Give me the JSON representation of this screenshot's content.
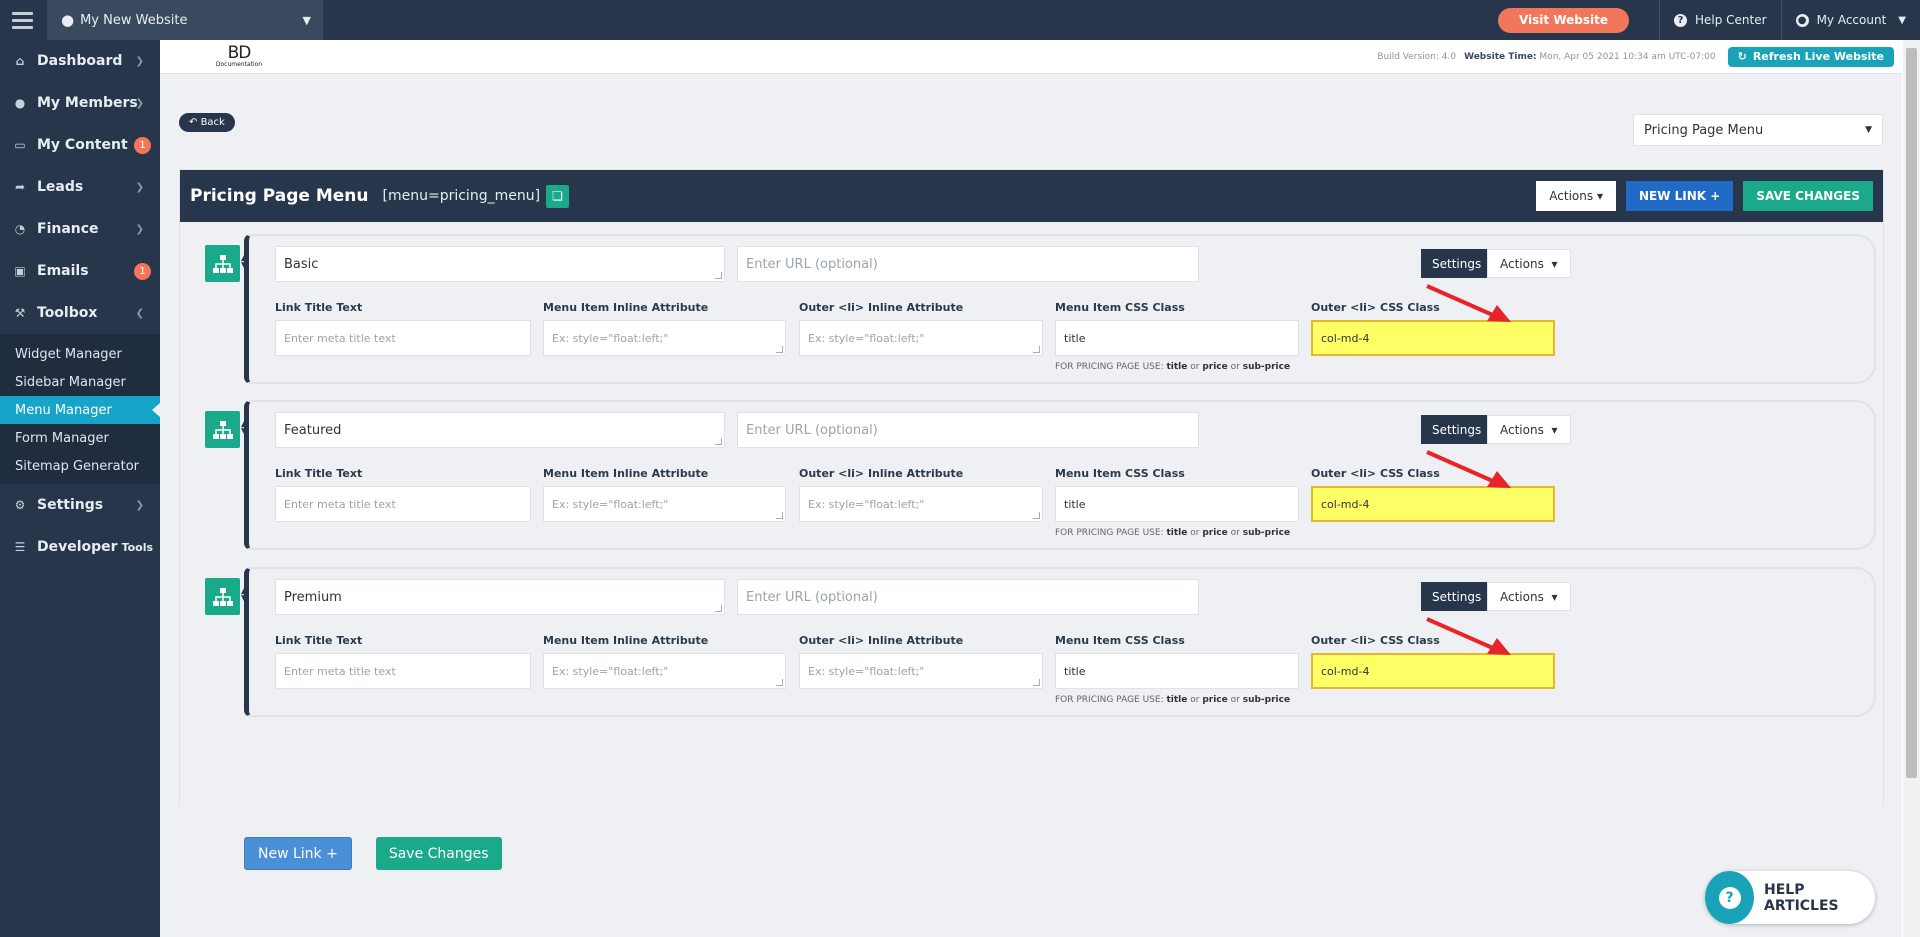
{
  "topbar": {
    "site_name": "My New Website",
    "visit_label": "Visit Website",
    "help_label": "Help Center",
    "account_label": "My Account"
  },
  "sidebar": {
    "items": [
      {
        "label": "Dashboard",
        "icon": "home-icon"
      },
      {
        "label": "My Members",
        "icon": "users-icon"
      },
      {
        "label": "My Content",
        "icon": "folder-icon",
        "badge": "1"
      },
      {
        "label": "Leads",
        "icon": "share-icon"
      },
      {
        "label": "Finance",
        "icon": "pie-chart-icon"
      },
      {
        "label": "Emails",
        "icon": "inbox-icon",
        "badge": "1"
      },
      {
        "label": "Toolbox",
        "icon": "wrench-icon"
      },
      {
        "label": "Settings",
        "icon": "gear-icon"
      },
      {
        "label": "Developer",
        "sub": "Tools",
        "icon": "sliders-icon"
      }
    ],
    "subitems": [
      "Widget Manager",
      "Sidebar Manager",
      "Menu Manager",
      "Form Manager",
      "Sitemap Generator"
    ]
  },
  "subheader": {
    "logo_main": "BD",
    "logo_sub": "Documentation",
    "build": "Build Version: 4.0",
    "time_label": "Website Time:",
    "time_value": "Mon, Apr 05 2021 10:34 am UTC-07:00",
    "refresh": "Refresh Live Website"
  },
  "back_label": "Back",
  "menu_select": "Pricing Page Menu",
  "panel": {
    "title": "Pricing Page Menu",
    "shortcode": "[menu=pricing_menu]",
    "actions": "Actions",
    "new_link": "NEW LINK +",
    "save": "SAVE CHANGES"
  },
  "labels": {
    "link_title": "Link Title Text",
    "inline_attr": "Menu Item Inline Attribute",
    "outer_inline": "Outer <li> Inline Attribute",
    "css_class": "Menu Item CSS Class",
    "outer_css": "Outer <li> CSS Class",
    "settings": "Settings",
    "actions": "Actions",
    "url_placeholder": "Enter URL (optional)",
    "meta_placeholder": "Enter meta title text",
    "style_placeholder": "Ex: style=\"float:left;\"",
    "hint_prefix": "FOR PRICING PAGE USE:",
    "hint_title": "title",
    "hint_or": "or",
    "hint_price": "price",
    "hint_sub": "sub-price"
  },
  "items": [
    {
      "title": "Basic",
      "css": "title",
      "outer_css": "col-md-4"
    },
    {
      "title": "Featured",
      "css": "title",
      "outer_css": "col-md-4"
    },
    {
      "title": "Premium",
      "css": "title",
      "outer_css": "col-md-4"
    }
  ],
  "bottom": {
    "new_link": "New Link +",
    "save": "Save Changes"
  },
  "help": "HELP ARTICLES",
  "colors": {
    "navy": "#27364a",
    "teal": "#1aa98a",
    "highlight": "#ffff66",
    "arrow": "#e8232a",
    "orange": "#f2775a"
  }
}
